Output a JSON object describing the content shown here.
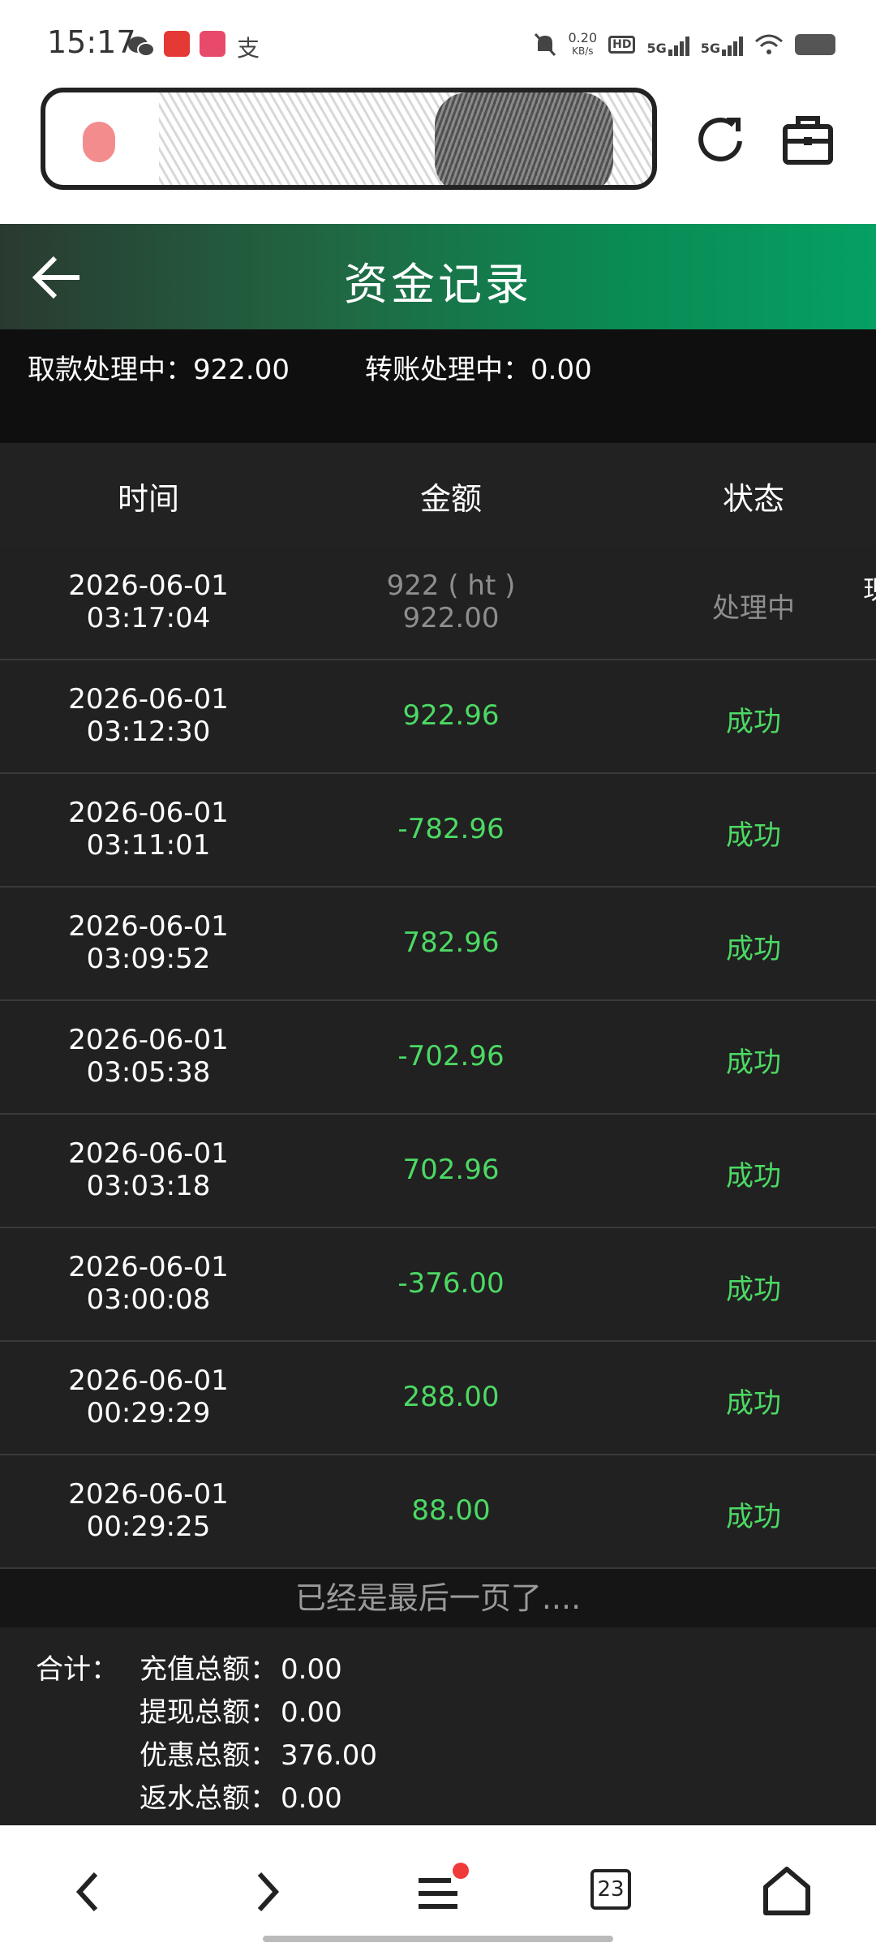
{
  "status_bar": {
    "time": "15:17",
    "net_speed_value": "0.20",
    "net_speed_unit": "KB/s",
    "hd_label": "HD",
    "sim1_label": "5G",
    "sim2_label": "5G",
    "icons": [
      "wechat-icon",
      "video-app-icon",
      "bilibili-icon",
      "alipay-icon",
      "mute-icon",
      "wifi-icon",
      "battery-icon"
    ]
  },
  "header": {
    "title": "资金记录"
  },
  "pending": {
    "withdraw": "取款处理中：922.00",
    "transfer": "转账处理中：0.00"
  },
  "table": {
    "headers": [
      "时间",
      "金额",
      "状态"
    ],
    "rows": [
      {
        "date": "2026-06-01",
        "time": "03:17:04",
        "amount_line1": "922 ( ht )",
        "amount": "922.00",
        "status": "处理中",
        "state": "pending"
      },
      {
        "date": "2026-06-01",
        "time": "03:12:30",
        "amount": "922.96",
        "status": "成功",
        "state": "ok"
      },
      {
        "date": "2026-06-01",
        "time": "03:11:01",
        "amount": "-782.96",
        "status": "成功",
        "state": "ok"
      },
      {
        "date": "2026-06-01",
        "time": "03:09:52",
        "amount": "782.96",
        "status": "成功",
        "state": "ok"
      },
      {
        "date": "2026-06-01",
        "time": "03:05:38",
        "amount": "-702.96",
        "status": "成功",
        "state": "ok"
      },
      {
        "date": "2026-06-01",
        "time": "03:03:18",
        "amount": "702.96",
        "status": "成功",
        "state": "ok"
      },
      {
        "date": "2026-06-01",
        "time": "03:00:08",
        "amount": "-376.00",
        "status": "成功",
        "state": "ok"
      },
      {
        "date": "2026-06-01",
        "time": "00:29:29",
        "amount": "288.00",
        "status": "成功",
        "state": "ok"
      },
      {
        "date": "2026-06-01",
        "time": "00:29:25",
        "amount": "88.00",
        "status": "成功",
        "state": "ok"
      }
    ],
    "clipped_text": "现"
  },
  "footer": {
    "last_page": "已经是最后一页了....",
    "totals_label": "合计：",
    "totals": [
      {
        "label": "充值总额：",
        "value": "0.00"
      },
      {
        "label": "提现总额：",
        "value": "0.00"
      },
      {
        "label": "优惠总额：",
        "value": "376.00"
      },
      {
        "label": "返水总额：",
        "value": "0.00"
      }
    ]
  },
  "bottom_nav": {
    "tab_count": "23"
  },
  "colors": {
    "success": "#4cd964",
    "pending": "#8e8e8e",
    "header_green": "#06a063"
  }
}
